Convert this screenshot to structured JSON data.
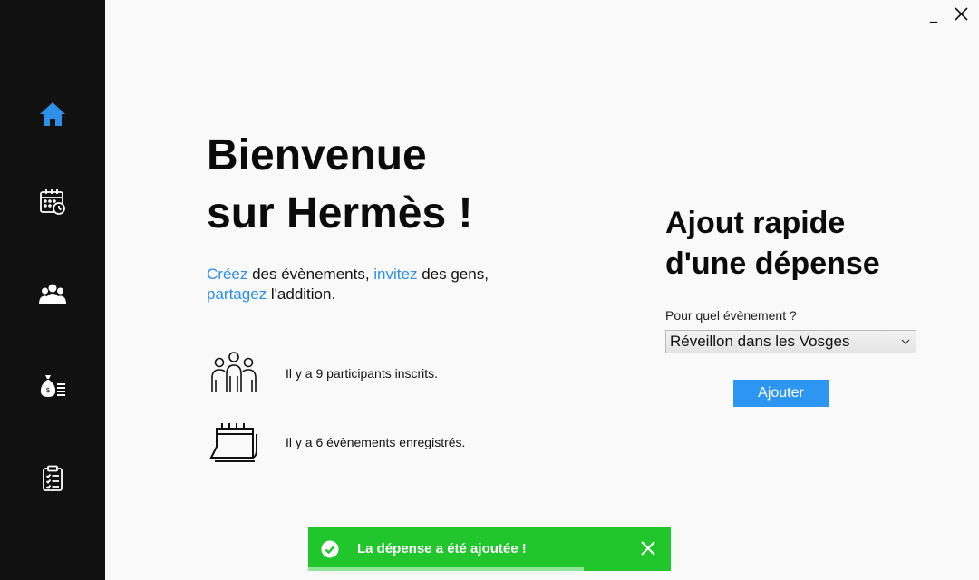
{
  "window": {
    "minimize_label": "_",
    "close_label": "✕"
  },
  "sidebar": {
    "active_color": "#2d8fe8",
    "items": [
      {
        "icon": "home-icon",
        "active": true
      },
      {
        "icon": "calendar-icon",
        "active": false
      },
      {
        "icon": "group-icon",
        "active": false
      },
      {
        "icon": "money-bag-list-icon",
        "active": false
      },
      {
        "icon": "clipboard-icon",
        "active": false
      }
    ]
  },
  "welcome": {
    "title_line1": "Bienvenue",
    "title_line2": "sur Hermès !",
    "tagline": {
      "w1": "Créez",
      "t1": " des évènements, ",
      "w2": "invitez",
      "t2": " des gens,",
      "w3": "partagez",
      "t3": " l'addition."
    },
    "stats": {
      "participants": "Il y a 9 participants inscrits.",
      "events": "Il y a 6 évènements enregistrés."
    }
  },
  "quick_add": {
    "title_line1": "Ajout rapide",
    "title_line2": "d'une dépense",
    "event_label": "Pour quel évènement ?",
    "event_selected": "Réveillon dans les Vosges",
    "add_label": "Ajouter",
    "accent_color": "#2d95f2"
  },
  "toast": {
    "message": "La dépense a été ajoutée !",
    "color": "#21c62d",
    "progress": 0.76
  }
}
